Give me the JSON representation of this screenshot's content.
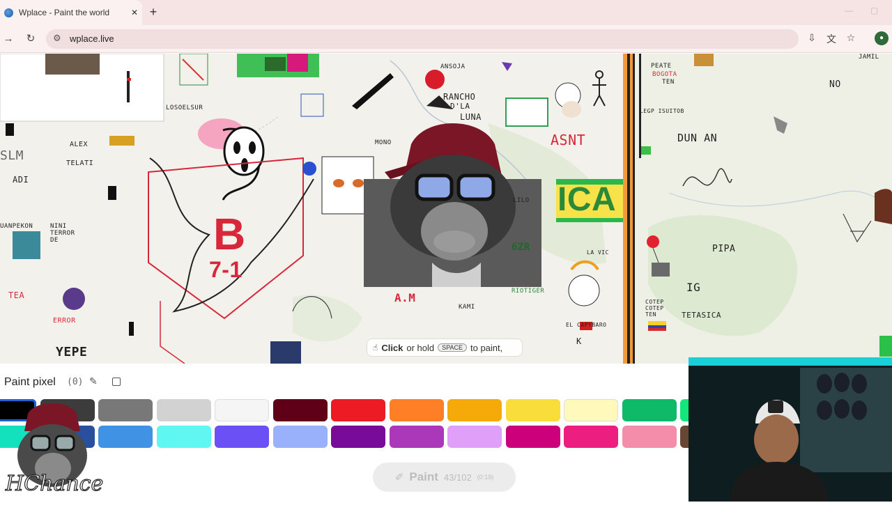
{
  "browser": {
    "tab_title": "Wplace - Paint the world",
    "tab_close": "✕",
    "new_tab": "+",
    "url": "wplace.live",
    "profile_initial": "●"
  },
  "map_labels": {
    "losoelsur": "LOSOELSUR",
    "ansoja": "ANSOJA",
    "rancho": "RANCHO",
    "dla": "D'LA",
    "luna": "LUNA",
    "mono": "MONO",
    "alex": "ALEX",
    "telati": "TELATI",
    "slm": "SLM",
    "adi": "ADI",
    "panpekon": "UANPEKON",
    "nini_terror": "NINI TERROR DE",
    "tea": "TEA",
    "error": "ERROR",
    "yepe": "YEPE",
    "b71_b": "B",
    "b71_score": "7-1",
    "ica": "ICA",
    "lilo": "LILO",
    "sab": "6ZR",
    "riotiger": "RIOTIGER",
    "am": "A.M",
    "kami": "KAMI",
    "la_vic": "LA VIC",
    "el_cap": "EL CAPYBARO",
    "asnt": "ASNT",
    "peate": "PEATE",
    "bogota": "BOGOTA",
    "ten": "TEN",
    "legp": "LEGP ISUITOB",
    "dun_an": "DUN AN",
    "no": "NO",
    "pipa": "PIPA",
    "ig": "IG",
    "cotep": "COTEP COTEP TEN",
    "tetasi": "TETASICA",
    "jamil": "JAMIL",
    "k": "K"
  },
  "hint": {
    "click": "Click",
    "or_hold": "or hold",
    "key": "SPACE",
    "to_paint": "to paint,"
  },
  "panel": {
    "title": "Paint pixel",
    "count": "(0)",
    "paint_label": "Paint",
    "charges": "43/102",
    "timer": "(0:19)"
  },
  "palette_row1": [
    "#000000",
    "#3c3c3c",
    "#787878",
    "#d2d2d2",
    "#f5f5f5",
    "#600018",
    "#ed1c24",
    "#ff7f27",
    "#f6aa09",
    "#f9dd3b",
    "#fffabc",
    "#0eb968",
    "#13e67b"
  ],
  "palette_row2": [
    "#13e1be",
    "#28509e",
    "#4093e4",
    "#60f7f2",
    "#6b50f6",
    "#99b1fb",
    "#780c99",
    "#aa38b9",
    "#e09ff9",
    "#cb007a",
    "#ec1f80",
    "#f38da9",
    "#684634"
  ],
  "overlay": {
    "logo_text": "HChance"
  }
}
